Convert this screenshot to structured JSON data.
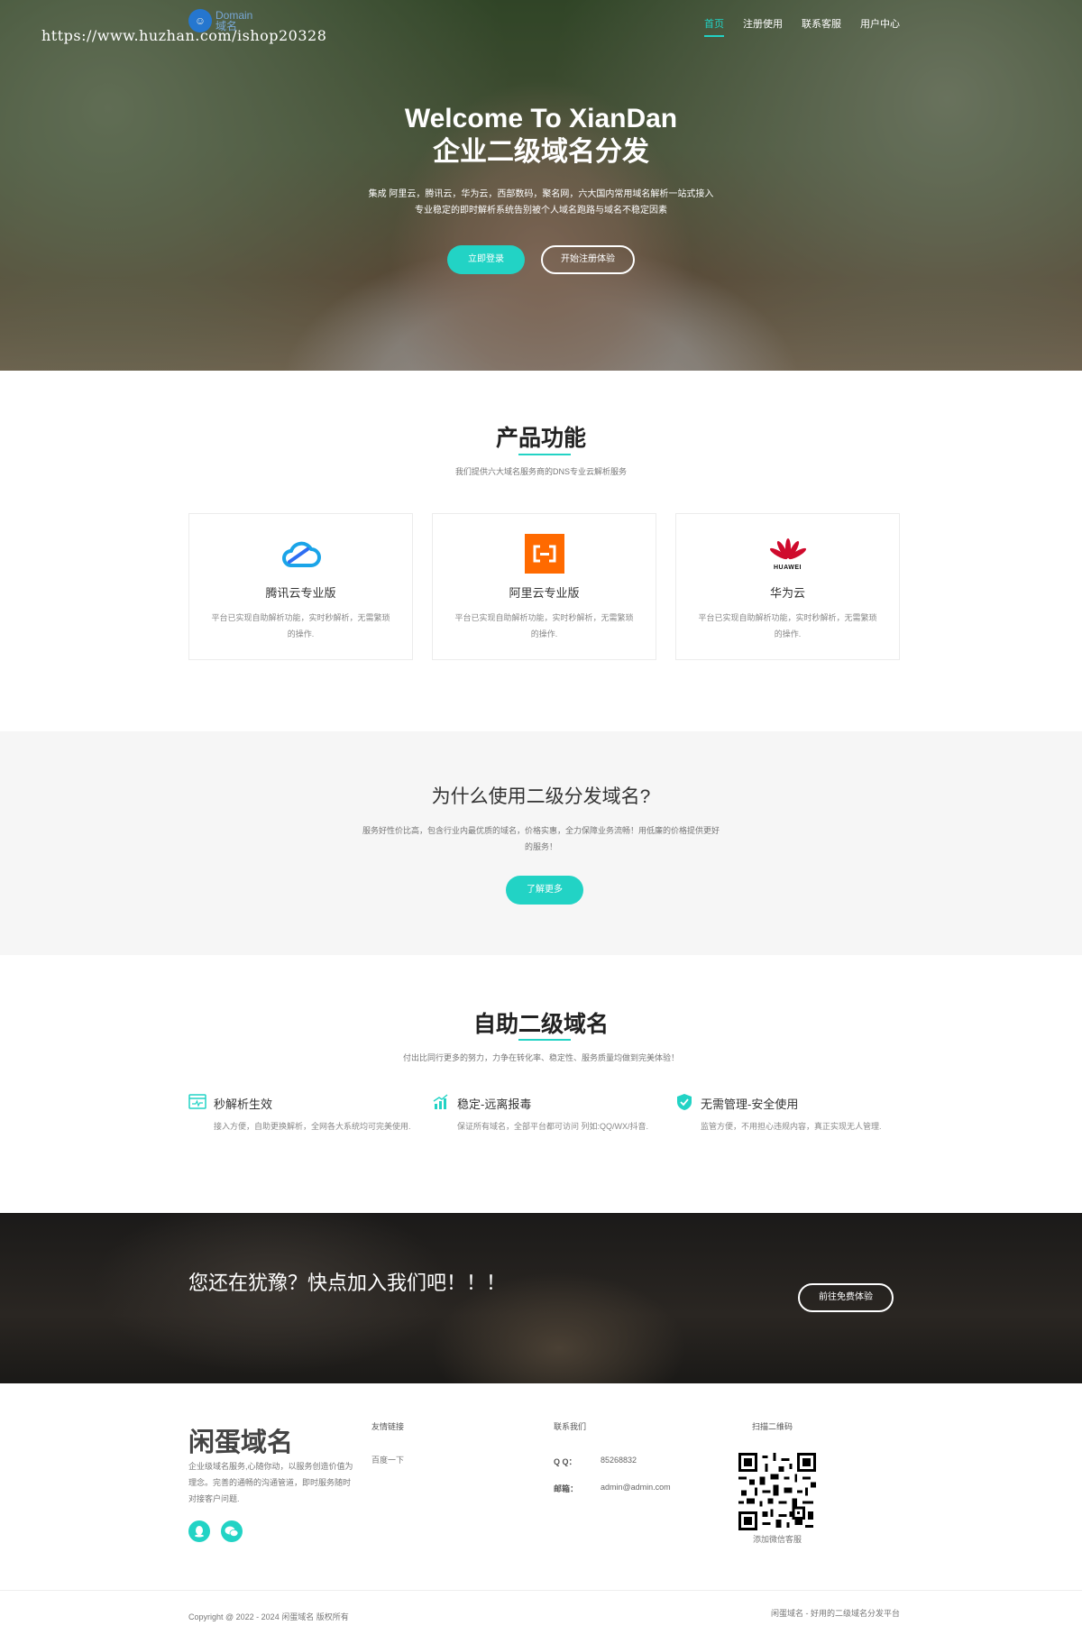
{
  "watermark": "https://www.huzhan.com/ishop20328",
  "logo": {
    "mark": "☺",
    "line1": "Domain",
    "line2": "域名"
  },
  "nav": [
    {
      "label": "首页",
      "active": true
    },
    {
      "label": "注册使用",
      "active": false
    },
    {
      "label": "联系客服",
      "active": false
    },
    {
      "label": "用户中心",
      "active": false
    }
  ],
  "hero": {
    "title_line1": "Welcome To XianDan",
    "title_line2": "企业二级域名分发",
    "sub_line1": "集成 阿里云，腾讯云，华为云，西部数码，聚名网，六大国内常用域名解析一站式接入",
    "sub_line2": "专业稳定的即时解析系统告别被个人域名跑路与域名不稳定因素",
    "btn_login": "立即登录",
    "btn_register": "开始注册体验"
  },
  "features": {
    "title": "产品功能",
    "subtitle": "我们提供六大域名服务商的DNS专业云解析服务",
    "cards": [
      {
        "name": "腾讯云专业版",
        "desc": "平台已实现自助解析功能，实时秒解析，无需繁琐的操作.",
        "icon": "tencent-cloud-icon"
      },
      {
        "name": "阿里云专业版",
        "desc": "平台已实现自助解析功能，实时秒解析，无需繁琐的操作.",
        "icon": "aliyun-icon"
      },
      {
        "name": "华为云",
        "desc": "平台已实现自助解析功能，实时秒解析，无需繁琐的操作.",
        "icon": "huawei-icon",
        "brand_text": "HUAWEI"
      }
    ]
  },
  "why": {
    "title": "为什么使用二级分发域名?",
    "desc": "服务好性价比高，包含行业内最优质的域名，价格实惠，全力保障业务流畅！用低廉的价格提供更好的服务！",
    "button": "了解更多"
  },
  "self_service": {
    "title": "自助二级域名",
    "subtitle": "付出比同行更多的努力，力争在转化率、稳定性、服务质量均做到完美体验！",
    "items": [
      {
        "title": "秒解析生效",
        "desc": "接入方便，自助更换解析，全网各大系统均可完美使用.",
        "icon": "monitor-pulse-icon"
      },
      {
        "title": "稳定-远离报毒",
        "desc": "保证所有域名，全部平台都可访问 列如:QQ/WX/抖音.",
        "icon": "bar-chart-icon"
      },
      {
        "title": "无需管理-安全使用",
        "desc": "监管方便，不用担心违规内容，真正实现无人管理.",
        "icon": "shield-check-icon"
      }
    ]
  },
  "cta": {
    "text": "您还在犹豫？快点加入我们吧！！！",
    "button": "前往免费体验"
  },
  "footer": {
    "brand": "闲蛋域名",
    "about": "企业级域名服务,心随你动，以服务创造价值为理念。完善的通畅的沟通管道，即时服务随时对接客户问题.",
    "links_title": "友情链接",
    "links": [
      "百度一下"
    ],
    "contact_title": "联系我们",
    "qq_label": "Q Q：",
    "qq_value": "85268832",
    "email_label": "邮箱：",
    "email_value": "admin@admin.com",
    "qr_title": "扫描二维码",
    "qr_caption": "添加微信客服",
    "copyright": "Copyright @ 2022 - 2024 闲蛋域名 版权所有",
    "slogan": "闲蛋域名 - 好用的二级域名分发平台"
  },
  "colors": {
    "accent": "#22d3c5",
    "logo_blue": "#1e7be8",
    "aliyun_orange": "#ff6a00",
    "huawei_red": "#cf0a2c"
  }
}
